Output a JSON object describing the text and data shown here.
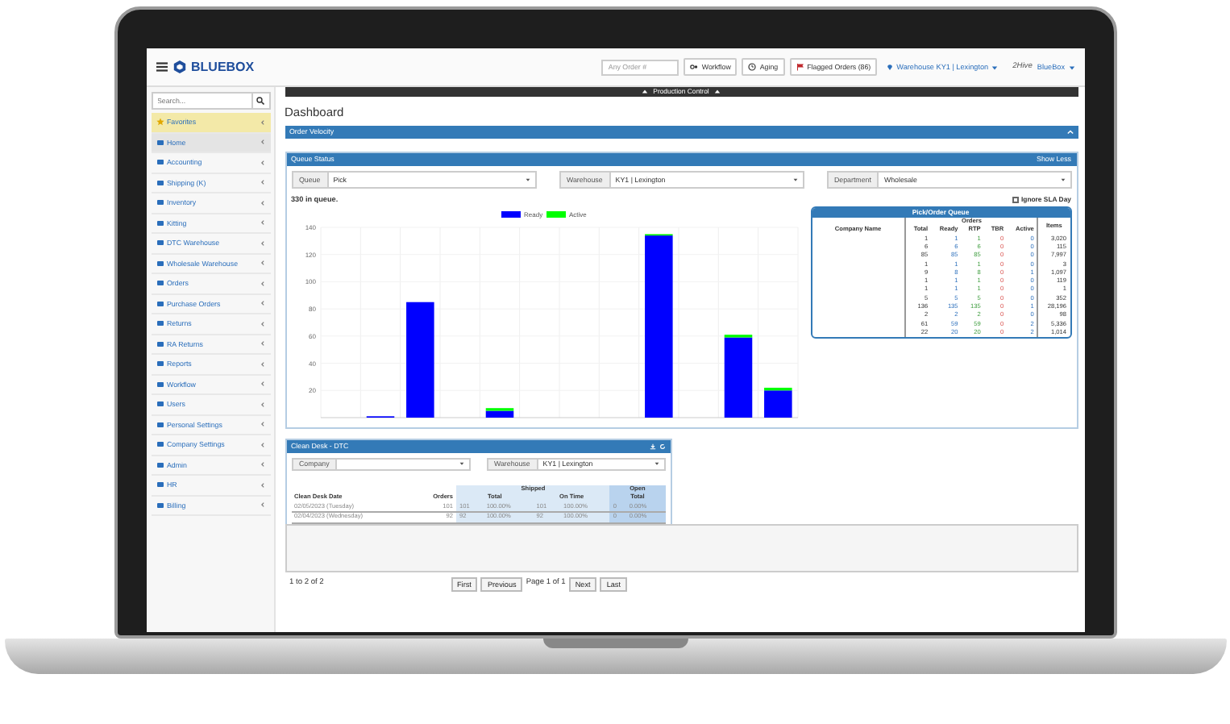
{
  "topbar": {
    "logo": "BLUEBOX",
    "search_placeholder": "Any Order #",
    "buttons": [
      {
        "label": "Workflow",
        "kind": "workflow"
      },
      {
        "label": "Aging",
        "kind": "aging"
      },
      {
        "label": "Flagged Orders (86)",
        "kind": "flag"
      }
    ],
    "warehouse": "Warehouse KY1 | Lexington",
    "user_logo": "2Hive",
    "user": "BlueBox"
  },
  "sidebar": {
    "search_placeholder": "Search...",
    "items": [
      {
        "label": "Favorites",
        "kind": "favorites",
        "selected": false
      },
      {
        "label": "Home",
        "kind": "menu",
        "selected": true
      },
      {
        "label": "Accounting",
        "kind": "menu",
        "selected": false
      },
      {
        "label": "Shipping (K)",
        "kind": "menu",
        "selected": false
      },
      {
        "label": "Inventory",
        "kind": "menu",
        "selected": false
      },
      {
        "label": "Kitting",
        "kind": "menu",
        "selected": false
      },
      {
        "label": "DTC Warehouse",
        "kind": "menu",
        "selected": false
      },
      {
        "label": "Wholesale Warehouse",
        "kind": "menu",
        "selected": false
      },
      {
        "label": "Orders",
        "kind": "menu",
        "selected": false
      },
      {
        "label": "Purchase Orders",
        "kind": "menu",
        "selected": false
      },
      {
        "label": "Returns",
        "kind": "menu",
        "selected": false
      },
      {
        "label": "RA Returns",
        "kind": "menu",
        "selected": false
      },
      {
        "label": "Reports",
        "kind": "menu",
        "selected": false
      },
      {
        "label": "Workflow",
        "kind": "menu",
        "selected": false
      },
      {
        "label": "Users",
        "kind": "menu",
        "selected": false
      },
      {
        "label": "Personal Settings",
        "kind": "menu",
        "selected": false
      },
      {
        "label": "Company Settings",
        "kind": "menu",
        "selected": false
      },
      {
        "label": "Admin",
        "kind": "menu",
        "selected": false
      },
      {
        "label": "HR",
        "kind": "menu",
        "selected": false
      },
      {
        "label": "Billing",
        "kind": "menu",
        "selected": false
      }
    ]
  },
  "production_control": "Production Control",
  "page_title": "Dashboard",
  "order_velocity": {
    "title": "Order Velocity",
    "expanded": false
  },
  "queue_status": {
    "title": "Queue Status",
    "toggle": "Show Less",
    "filters": [
      {
        "label": "Queue",
        "value": "Pick"
      },
      {
        "label": "Warehouse",
        "value": "KY1 | Lexington"
      },
      {
        "label": "Department",
        "value": "Wholesale"
      }
    ],
    "count": "330 in queue.",
    "ignore_sla": {
      "label": "Ignore SLA Day",
      "checked": false
    },
    "chart_data": {
      "type": "bar",
      "stacked": true,
      "grid": true,
      "legend": true,
      "ylim": [
        0,
        140
      ],
      "yticks": [
        20,
        40,
        60,
        80,
        100,
        120,
        140
      ],
      "series": [
        {
          "name": "Ready",
          "color": "#0000ff",
          "values": [
            null,
            1,
            85,
            null,
            5,
            null,
            null,
            null,
            134,
            null,
            59,
            20
          ]
        },
        {
          "name": "Active",
          "color": "#00ff00",
          "values": [
            null,
            null,
            null,
            null,
            2,
            null,
            null,
            null,
            1,
            null,
            2,
            2
          ]
        }
      ]
    },
    "pick_queue": {
      "title": "Pick/Order Queue",
      "company_header": "Company Name",
      "group": "Orders",
      "columns": [
        "Total",
        "Ready",
        "RTP",
        "TBR",
        "Active"
      ],
      "items_header": "Items",
      "rows": [
        [
          "1",
          "1",
          "1",
          "0",
          "0",
          "3,020"
        ],
        [
          "6",
          "6",
          "6",
          "0",
          "0",
          "115"
        ],
        [
          "85",
          "85",
          "85",
          "0",
          "0",
          "7,997"
        ],
        [
          "1",
          "1",
          "1",
          "0",
          "0",
          "3"
        ],
        [
          "9",
          "8",
          "8",
          "0",
          "1",
          "1,097"
        ],
        [
          "1",
          "1",
          "1",
          "0",
          "0",
          "119"
        ],
        [
          "1",
          "1",
          "1",
          "0",
          "0",
          "1"
        ],
        [
          "5",
          "5",
          "5",
          "0",
          "0",
          "352"
        ],
        [
          "136",
          "135",
          "135",
          "0",
          "1",
          "28,196"
        ],
        [
          "2",
          "2",
          "2",
          "0",
          "0",
          "98"
        ],
        [
          "61",
          "59",
          "59",
          "0",
          "2",
          "5,336"
        ],
        [
          "22",
          "20",
          "20",
          "0",
          "2",
          "1,014"
        ]
      ]
    }
  },
  "clean_desk": {
    "title": "Clean Desk - DTC",
    "filters": [
      {
        "label": "Company"
      },
      {
        "label": "Warehouse",
        "value": "KY1 | Lexington"
      }
    ],
    "headers": {
      "date": "Clean Desk Date",
      "orders": "Orders",
      "shipped": "Shipped",
      "total": "Total",
      "on_time": "On Time",
      "open": "Open",
      "open_total": "Total"
    },
    "rows": [
      [
        "02/05/2023 (Tuesday)",
        "101",
        "101",
        "100.00%",
        "101",
        "100.00%",
        "0",
        "0.00%"
      ],
      [
        "02/04/2023 (Wednesday)",
        "92",
        "92",
        "100.00%",
        "92",
        "100.00%",
        "0",
        "0.00%"
      ]
    ]
  },
  "pagination": {
    "summary": "1 to 2 of 2",
    "before": [
      "First",
      "Previous"
    ],
    "page": "Page 1 of 1",
    "after": [
      "Next",
      "Last"
    ]
  }
}
